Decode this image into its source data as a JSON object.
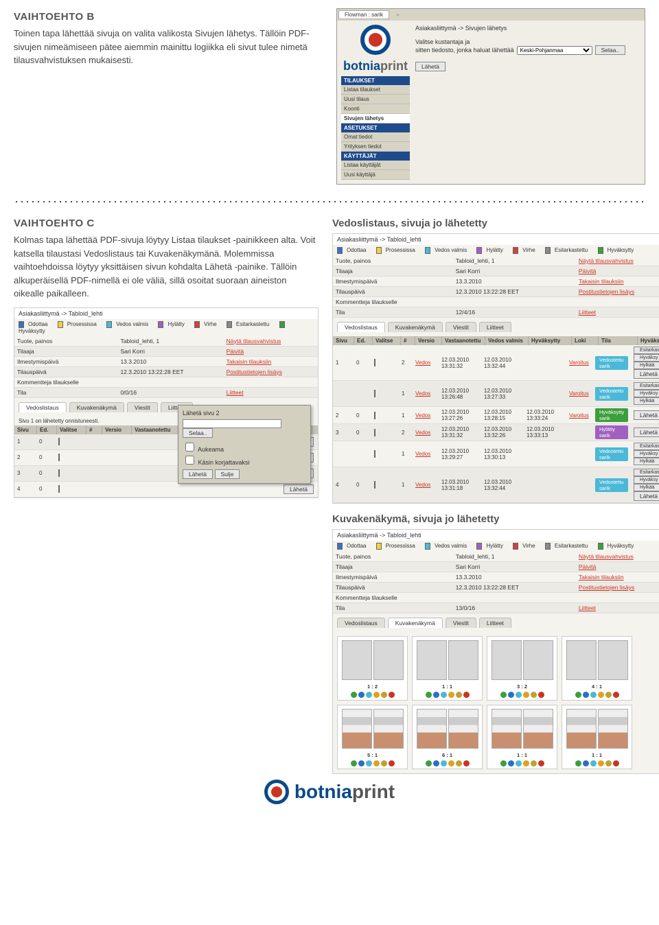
{
  "sectionB": {
    "title": "VAIHTOEHTO B",
    "text": "Toinen tapa lähettää sivuja on valita valikosta Sivujen lähetys. Tällöin PDF-sivujen nimeämiseen pätee aiemmin mainittu logiikka eli sivut tulee nimetä tilausvahvistuksen mukaisesti."
  },
  "flowman": {
    "tabLabel": "Flowman : sarik",
    "breadcrumb": "Asiakasliittymä -> Sivujen lähetys",
    "instr1": "Valitse kustantaja ja",
    "instr2": "sitten tiedosto, jonka haluat lähettää",
    "select": "Keski-Pohjanmaa",
    "browse": "Selaa..",
    "send": "Lähetä",
    "sidebar": {
      "h1": "TILAUKSET",
      "i1": "Listaa tilaukset",
      "i2": "Uusi tilaus",
      "i3": "Koonti",
      "i4": "Sivujen lähetys",
      "h2": "ASETUKSET",
      "i5": "Omat tiedot",
      "i6": "Yrityksen tiedot",
      "h3": "KÄYTTÄJÄT",
      "i7": "Listaa käyttäjät",
      "i8": "Uusi käyttäjä"
    }
  },
  "sectionC": {
    "title": "VAIHTOEHTO C",
    "text": "Kolmas tapa lähettää PDF-sivuja löytyy Listaa tilaukset -painikkeen alta. Voit katsella tilaustasi Vedoslistaus tai Kuvakenäkymänä. Molemmissa vaihtoehdoissa löytyy yksittäisen sivun kohdalta Lähetä -painike. Tällöin alkuperäisellä PDF-nimellä ei ole väliä, sillä osoitat suoraan aineiston oikealle paikalleen."
  },
  "panelLeft": {
    "breadcrumb": "Asiakasliittymä -> Tabloid_lehti",
    "legend": {
      "l1": "Odottaa",
      "l2": "Prosessissa",
      "l3": "Vedos valmis",
      "l4": "Hylätty",
      "l5": "Virhe",
      "l6": "Esitarkastettu",
      "l7": "Hyväksytty"
    },
    "rows": {
      "r1a": "Tuote, painos",
      "r1b": "Tabloid_lehti, 1",
      "r1c": "Näytä tilausvahvistus",
      "r2a": "Tilaaja",
      "r2b": "Sari Korri",
      "r2c": "Päivitä",
      "r3a": "Ilmestymispäivä",
      "r3b": "13.3.2010",
      "r3c": "Takaisin tilauksiin",
      "r4a": "Tilauspäivä",
      "r4b": "12.3.2010 13:22:28 EET",
      "r4c": "Postitustietojen lisäys",
      "r5a": "Kommentteja tilaukselle",
      "r5b": "",
      "r5c": "",
      "r6a": "Tila",
      "r6b": "0/0/16",
      "r6c": "Liitteet"
    },
    "tabs": {
      "t1": "Vedoslistaus",
      "t2": "Kuvakenäkymä",
      "t3": "Viestit",
      "t4": "Liitteet"
    },
    "success": "Sivu 1 on lähetetty onnistuneesti.",
    "gridH": {
      "c1": "Sivu",
      "c2": "Ed.",
      "c3": "Valitse",
      "c4": "#",
      "c5": "Versio",
      "c6": "Vastaanotettu",
      "c7": "Vedos valmis",
      "c8": "Hyväksytty",
      "c9": "Loki"
    },
    "send": "Lähetä",
    "popup": {
      "title": "Lähetä sivu 2",
      "browse": "Selaa..",
      "chk1": "Aukeama",
      "chk2": "Käsin korjattavaksi",
      "btn1": "Lähetä",
      "btn2": "Sulje"
    }
  },
  "vedos": {
    "title": "Vedoslistaus, sivuja jo lähetetty",
    "breadcrumb": "Asiakasliittymä -> Tabloid_lehti",
    "rows": {
      "r6b": "12/4/16"
    },
    "gridH": {
      "c10": "Tila",
      "c11": "Hyväksy/Hylkää"
    },
    "items": [
      {
        "sivu": "1",
        "ed": "0",
        "ver": "2",
        "vedos": "Vedos",
        "t1": "12.03.2010 13:31:32",
        "t2": "12.03.2010 13:32:44",
        "loki": "Varoitus",
        "tila": "Vedostettu sarik",
        "tilaCls": "cyan",
        "a1": "Esitarkastettu",
        "a2": "Hyväksy",
        "a3": "Hylkää",
        "send": "Lähetä"
      },
      {
        "sivu": "",
        "ed": "",
        "ver": "1",
        "vedos": "Vedos",
        "t1": "12.03.2010 13:26:48",
        "t2": "12.03.2010 13:27:33",
        "loki": "Varoitus",
        "tila": "Vedostettu sarik",
        "tilaCls": "cyan",
        "a1": "Esitarkastettu",
        "a2": "Hyväksy",
        "a3": "Hylkää",
        "send": ""
      },
      {
        "sivu": "2",
        "ed": "0",
        "ver": "1",
        "vedos": "Vedos",
        "t1": "12.03.2010 13:27:26",
        "t2": "12.03.2010 13:28:15",
        "t3": "12.03.2010 13:33:24",
        "loki": "Varoitus",
        "tila": "Hyväksytty sarik",
        "tilaCls": "green",
        "send": "Lähetä"
      },
      {
        "sivu": "3",
        "ed": "0",
        "ver": "2",
        "vedos": "Vedos",
        "t1": "12.03.2010 13:31:32",
        "t2": "12.03.2010 13:32:26",
        "t3": "12.03.2010 13:33:13",
        "loki": "",
        "tila": "Hylätty sarik",
        "tilaCls": "purple",
        "send": "Lähetä"
      },
      {
        "sivu": "",
        "ed": "",
        "ver": "1",
        "vedos": "Vedos",
        "t1": "12.03.2010 13:29:27",
        "t2": "12.03.2010 13:30:13",
        "loki": "",
        "tila": "Vedostettu sarik",
        "tilaCls": "cyan",
        "a1": "Esitarkastettu",
        "a2": "Hyväksy",
        "a3": "Hylkää",
        "send": ""
      },
      {
        "sivu": "4",
        "ed": "0",
        "ver": "1",
        "vedos": "Vedos",
        "t1": "12.03.2010 13:31:18",
        "t2": "12.03.2010 13:32:44",
        "loki": "",
        "tila": "Vedostettu sarik",
        "tilaCls": "cyan",
        "a1": "Esitarkastettu",
        "a2": "Hyväksy",
        "a3": "Hylkää",
        "send": "Lähetä"
      }
    ]
  },
  "kuva": {
    "title": "Kuvakenäkymä, sivuja jo lähetetty",
    "rows": {
      "r6b": "13/0/16"
    },
    "cells": [
      {
        "num": "1 : 2",
        "content": false
      },
      {
        "num": "1 : 1",
        "content": false
      },
      {
        "num": "3 : 2",
        "content": false
      },
      {
        "num": "4 : 1",
        "content": false
      },
      {
        "num": "5 : 1",
        "content": true
      },
      {
        "num": "6 : 1",
        "content": true
      },
      {
        "num": "1 : 1",
        "content": true
      },
      {
        "num": "1 : 1",
        "content": true
      }
    ]
  },
  "logo": {
    "bo": "botnia",
    "pr": "print"
  }
}
